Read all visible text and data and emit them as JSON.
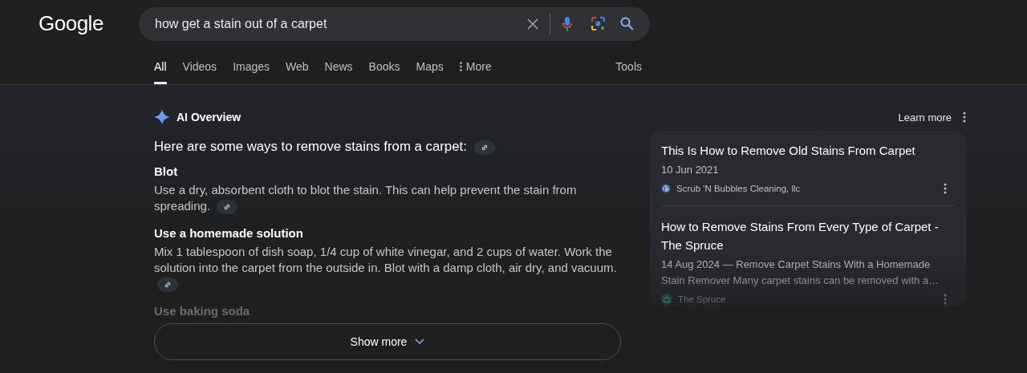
{
  "logo": "Google",
  "search": {
    "value": "how get a stain out of a carpet"
  },
  "tabs": [
    {
      "label": "All",
      "selected": true,
      "kind": "plain"
    },
    {
      "label": "Videos",
      "selected": false,
      "kind": "plain"
    },
    {
      "label": "Images",
      "selected": false,
      "kind": "plain"
    },
    {
      "label": "Web",
      "selected": false,
      "kind": "plain"
    },
    {
      "label": "News",
      "selected": false,
      "kind": "plain"
    },
    {
      "label": "Books",
      "selected": false,
      "kind": "plain"
    },
    {
      "label": "Maps",
      "selected": false,
      "kind": "plain"
    },
    {
      "label": "More",
      "selected": false,
      "kind": "menu"
    }
  ],
  "tools": "Tools",
  "ai_overview": {
    "title": "AI Overview",
    "learn_more": "Learn more",
    "intro": "Here are some ways to remove stains from a carpet:",
    "sections": [
      {
        "heading": "Blot",
        "body": "Use a dry, absorbent cloth to blot the stain. This can help prevent the stain from spreading."
      },
      {
        "heading": "Use a homemade solution",
        "body": "Mix 1 tablespoon of dish soap, 1/4 cup of white vinegar, and 2 cups of water. Work the solution into the carpet from the outside in. Blot with a damp cloth, air dry, and vacuum."
      },
      {
        "heading": "Use baking soda"
      }
    ],
    "show_more": "Show more",
    "sources": [
      {
        "title": "This Is How to Remove Old Stains From Carpet",
        "snippet": "10 Jun 2021",
        "site": "Scrub 'N Bubbles Cleaning, llc",
        "kind": "globe"
      },
      {
        "title": "How to Remove Stains From Every Type of Carpet - The Spruce",
        "snippet": "14 Aug 2024 — Remove Carpet Stains With a Homemade Stain Remover Many carpet stains can be removed with a…",
        "site": "The Spruce",
        "kind": "house"
      }
    ]
  }
}
